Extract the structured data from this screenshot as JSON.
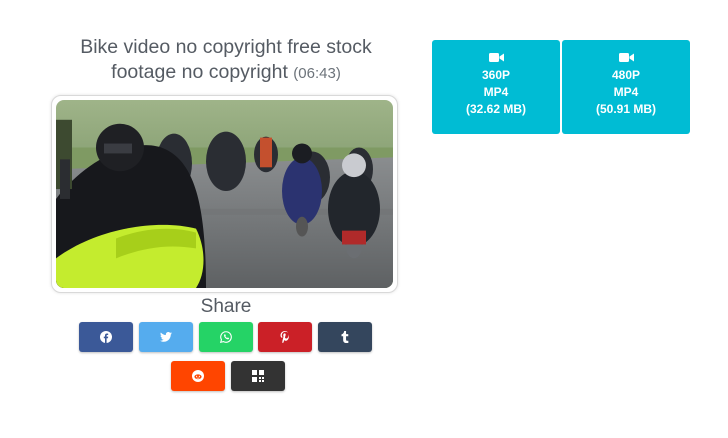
{
  "video": {
    "title": "Bike video no copyright free stock footage no copyright",
    "duration": "(06:43)"
  },
  "share": {
    "label": "Share",
    "buttons": [
      {
        "name": "facebook",
        "color": "#3b5998",
        "icon": "facebook-icon"
      },
      {
        "name": "twitter",
        "color": "#55acee",
        "icon": "twitter-icon"
      },
      {
        "name": "whatsapp",
        "color": "#25d366",
        "icon": "whatsapp-icon"
      },
      {
        "name": "pinterest",
        "color": "#cb2027",
        "icon": "pinterest-icon"
      },
      {
        "name": "tumblr",
        "color": "#34465d",
        "icon": "tumblr-icon"
      },
      {
        "name": "reddit",
        "color": "#ff4500",
        "icon": "reddit-icon"
      },
      {
        "name": "qrcode",
        "color": "#333333",
        "icon": "qrcode-icon"
      }
    ]
  },
  "downloads": [
    {
      "quality": "360P",
      "format": "MP4",
      "size": "(32.62 MB)",
      "icon": "video-camera-icon"
    },
    {
      "quality": "480P",
      "format": "MP4",
      "size": "(50.91 MB)",
      "icon": "video-camera-icon"
    }
  ],
  "colors": {
    "download_bg": "#00bcd4",
    "title_text": "#555b63"
  }
}
